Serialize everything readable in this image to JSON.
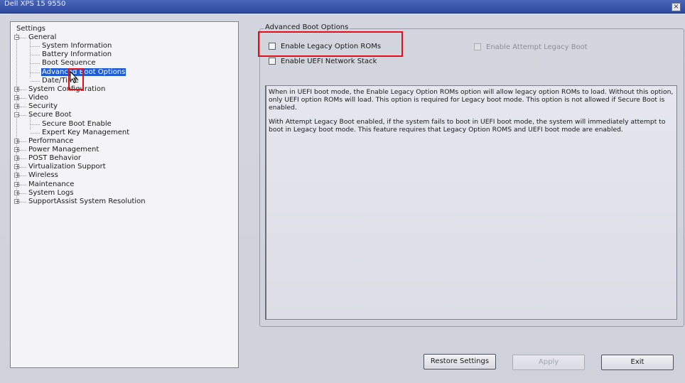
{
  "window": {
    "title": "Dell XPS 15 9550",
    "close_glyph": "×"
  },
  "tree": {
    "root": "Settings",
    "items": [
      {
        "label": "General",
        "level": 1,
        "expander": "−"
      },
      {
        "label": "System Information",
        "level": 2
      },
      {
        "label": "Battery Information",
        "level": 2
      },
      {
        "label": "Boot Sequence",
        "level": 2
      },
      {
        "label": "Advanced Boot Options",
        "level": 2,
        "selected": true
      },
      {
        "label": "Date/Time",
        "level": 2
      },
      {
        "label": "System Configuration",
        "level": 1,
        "expander": "+"
      },
      {
        "label": "Video",
        "level": 1,
        "expander": "+"
      },
      {
        "label": "Security",
        "level": 1,
        "expander": "+"
      },
      {
        "label": "Secure Boot",
        "level": 1,
        "expander": "−"
      },
      {
        "label": "Secure Boot Enable",
        "level": 2
      },
      {
        "label": "Expert Key Management",
        "level": 2
      },
      {
        "label": "Performance",
        "level": 1,
        "expander": "+"
      },
      {
        "label": "Power Management",
        "level": 1,
        "expander": "+"
      },
      {
        "label": "POST Behavior",
        "level": 1,
        "expander": "+"
      },
      {
        "label": "Virtualization Support",
        "level": 1,
        "expander": "+"
      },
      {
        "label": "Wireless",
        "level": 1,
        "expander": "+"
      },
      {
        "label": "Maintenance",
        "level": 1,
        "expander": "+"
      },
      {
        "label": "System Logs",
        "level": 1,
        "expander": "+"
      },
      {
        "label": "SupportAssist System Resolution",
        "level": 1,
        "expander": "+"
      }
    ]
  },
  "panel": {
    "group_title": "Advanced Boot Options",
    "options": {
      "legacy_roms": {
        "label": "Enable Legacy Option ROMs",
        "checked": false
      },
      "uefi_network": {
        "label": "Enable UEFI Network Stack",
        "checked": false
      },
      "attempt_legacy": {
        "label": "Enable Attempt Legacy Boot",
        "checked": false,
        "disabled": true
      }
    },
    "description": [
      "When in UEFI boot mode, the Enable Legacy Option ROMs option will allow legacy option ROMs to load. Without this option, only UEFI option ROMs will load. This option is required for Legacy boot mode. This option is not allowed if Secure Boot is enabled.",
      "With Attempt Legacy Boot enabled, if the system fails to boot in UEFI boot mode, the system will immediately attempt to boot in Legacy boot mode. This feature requires that Legacy Option ROMS and UEFI boot mode are enabled."
    ]
  },
  "buttons": {
    "restore": "Restore Settings",
    "apply": "Apply",
    "exit": "Exit"
  },
  "colors": {
    "selection": "#1f5cd1",
    "annotation": "#e0101a"
  }
}
